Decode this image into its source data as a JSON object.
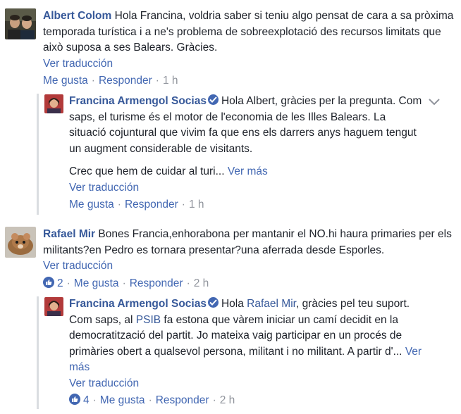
{
  "comments": [
    {
      "author": "Albert Colom",
      "text": "Hola Francina, voldria saber si teniu algo pensat de cara a sa pròxima temporada turística i a ne's problema de sobreexplotació des recursos limitats que això suposa a ses Balears. Gràcies.",
      "translate": "Ver traducción",
      "like": "Me gusta",
      "reply": "Responder",
      "time": "1 h"
    },
    {
      "author": "Francina Armengol Socias",
      "text_p1": "Hola Albert, gràcies per la pregunta. Com saps, el turisme és el motor de l'economia de les Illes Balears. La situació cojuntural que vivim fa que ens els darrers anys haguem tengut un augment considerable de visitants.",
      "text_p2": "Crec que hem de cuidar al turi...",
      "see_more": "Ver más",
      "translate": "Ver traducción",
      "like": "Me gusta",
      "reply": "Responder",
      "time": "1 h"
    },
    {
      "author": "Rafael Mir",
      "text": "Bones Francia,enhorabona per mantanir el NO.hi haura primaries per els militants?en Pedro es tornara presentar?una aferrada desde Esporles.",
      "translate": "Ver traducción",
      "reactions": "2",
      "like": "Me gusta",
      "reply": "Responder",
      "time": "2 h"
    },
    {
      "author": "Francina Armengol Socias",
      "text_a": "Hola",
      "mention": "Rafael Mir",
      "text_b": ", gràcies pel teu suport. Com saps, al",
      "tag": "PSIB",
      "text_c": "fa estona que vàrem iniciar un camí decidit en la democratització del partit. Jo mateixa vaig participar en un procés de primàries obert a qualsevol persona, militant i no militant. A partir d'...",
      "see_more": "Ver más",
      "translate": "Ver traducción",
      "reactions": "4",
      "like": "Me gusta",
      "reply": "Responder",
      "time": "2 h"
    }
  ],
  "colors": {
    "link": "#4267b2",
    "name": "#365899",
    "meta": "#90949c",
    "text": "#1d2129"
  },
  "icons": [
    "verified-badge-icon",
    "like-thumb-icon",
    "chevron-down-icon"
  ]
}
